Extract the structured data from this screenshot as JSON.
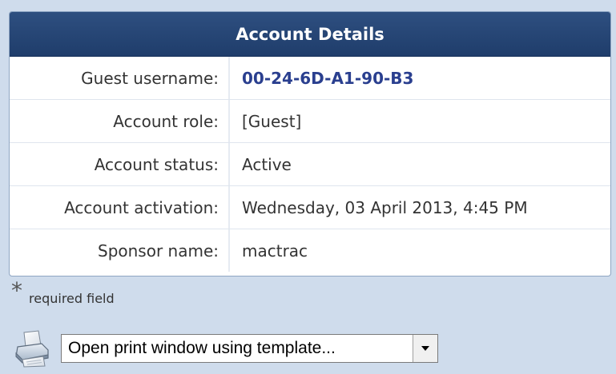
{
  "panel": {
    "title": "Account Details",
    "rows": [
      {
        "label": "Guest username:",
        "value": "00-24-6D-A1-90-B3"
      },
      {
        "label": "Account role:",
        "value": "[Guest]"
      },
      {
        "label": "Account status:",
        "value": "Active"
      },
      {
        "label": "Account activation:",
        "value": "Wednesday, 03 April 2013, 4:45 PM"
      },
      {
        "label": "Sponsor name:",
        "value": "mactrac"
      }
    ]
  },
  "required_note": {
    "symbol": "*",
    "text": "required field"
  },
  "print": {
    "icon": "printer-icon",
    "select_value": "Open print window using template...",
    "arrow_icon": "chevron-down-icon"
  },
  "colors": {
    "header_bg": "#1f3d6b",
    "page_bg": "#cfdcec",
    "highlight_text": "#2a3f8f"
  }
}
